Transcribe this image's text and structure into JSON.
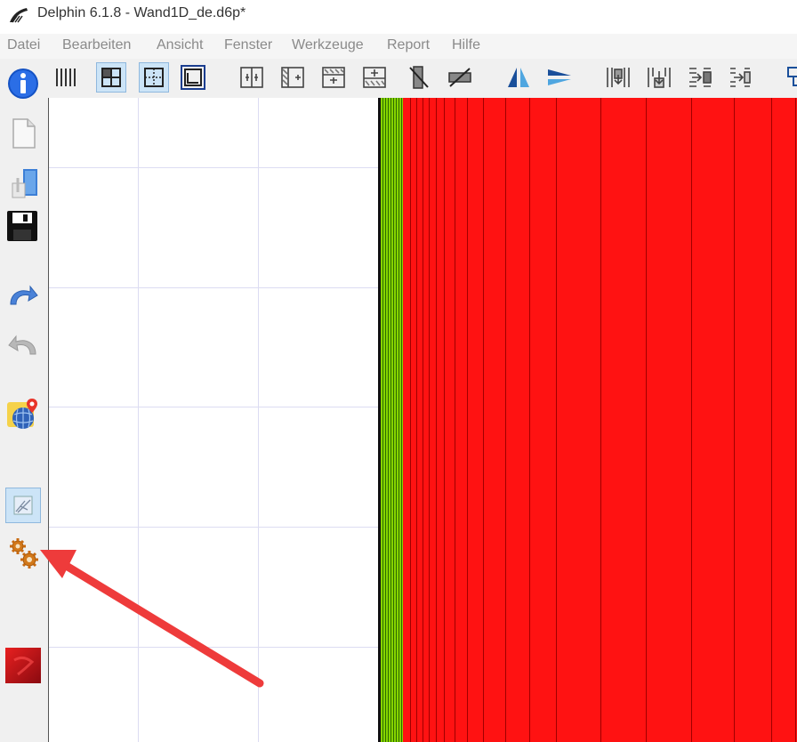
{
  "window": {
    "title": "Delphin 6.1.8 - Wand1D_de.d6p*"
  },
  "menu": {
    "items": [
      "Datei",
      "Bearbeiten",
      "Ansicht",
      "Fenster",
      "Werkzeuge",
      "Report",
      "Hilfe"
    ]
  },
  "toolbar": {
    "icons": [
      "columns-icon",
      "grid-select-icon",
      "grid-dashed-icon",
      "frame-icon",
      "split-vertical-icon",
      "merge-vertical-icon",
      "split-horizontal-icon",
      "merge-horizontal-icon",
      "delete-column-icon",
      "delete-row-icon",
      "mirror-vertical-icon",
      "mirror-horizontal-icon",
      "insert-column-icon",
      "insert-below-icon",
      "insert-left-icon",
      "insert-right-icon"
    ]
  },
  "sidebar": {
    "icons": [
      "info-icon",
      "new-file-icon",
      "open-file-icon",
      "save-icon",
      "undo-icon",
      "redo-icon",
      "globe-location-icon",
      "construction-view-icon",
      "simulation-settings-icon",
      "results-icon"
    ]
  },
  "colors": {
    "material_green": "#86d400",
    "material_red": "#ff1212",
    "annotation_arrow": "#ee3b3b"
  }
}
